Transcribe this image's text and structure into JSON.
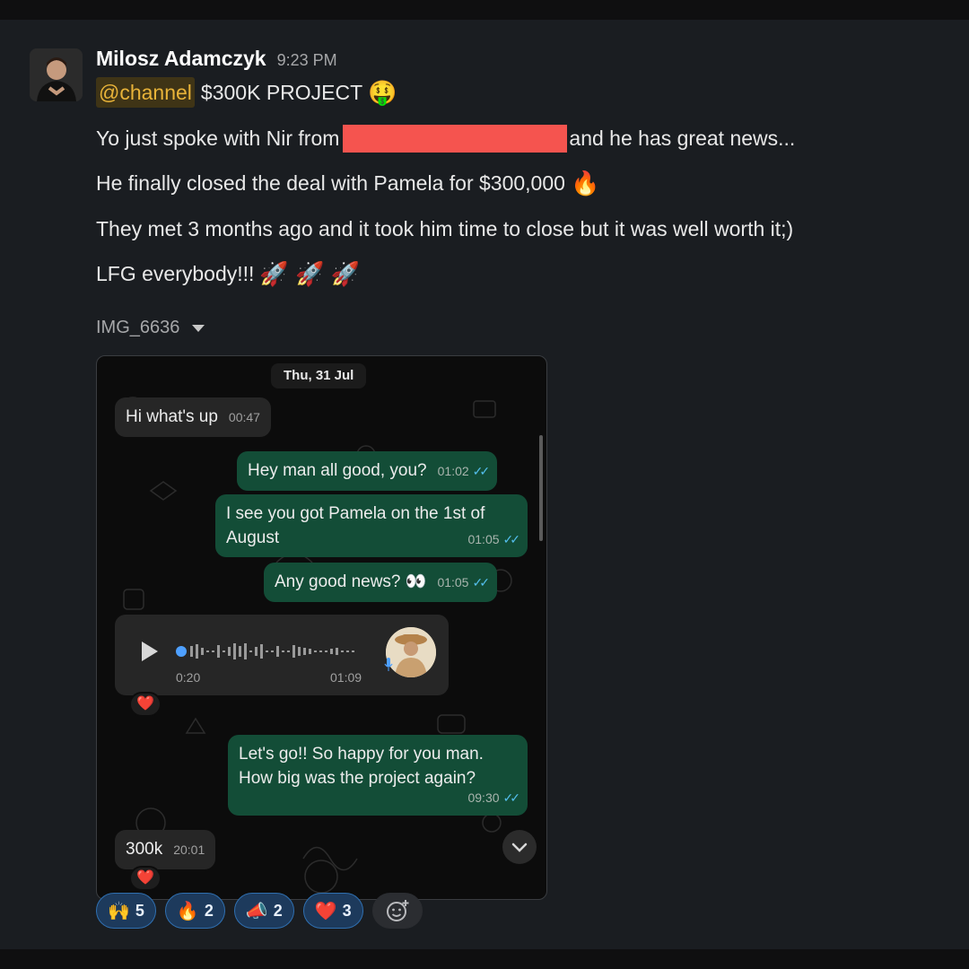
{
  "message": {
    "author": "Milosz Adamczyk",
    "time": "9:23 PM",
    "mention": "@channel",
    "headline": "$300K PROJECT",
    "headline_emoji": "🤑",
    "line1_before": "Yo just spoke with Nir from",
    "line1_after": "and he has great news...",
    "line2": "He finally closed the deal with Pamela for $300,000",
    "line2_emoji": "🔥",
    "line3": "They met 3 months ago and it took him time to close but it was well worth it;)",
    "line4": "LFG everybody!!!",
    "line4_emoji": "🚀 🚀 🚀",
    "attachment_name": "IMG_6636"
  },
  "chat": {
    "date": "Thu, 31 Jul",
    "messages": [
      {
        "text": "Hi what's up",
        "time": "00:47"
      },
      {
        "text": "Hey man all good, you?",
        "time": "01:02"
      },
      {
        "text_line1": "I see you got Pamela on the 1st of",
        "text_line2": "August",
        "time": "01:05"
      },
      {
        "text": "Any good news? 👀",
        "time": "01:05"
      },
      {
        "voice_position": "0:20",
        "voice_duration": "01:09",
        "reaction": "❤️"
      },
      {
        "text_line1": "Let's go!! So happy for you man.",
        "text_line2": "How big was the project again?",
        "time": "09:30"
      },
      {
        "text": "300k",
        "time": "20:01",
        "reaction": "❤️"
      }
    ]
  },
  "reactions": [
    {
      "emoji": "🙌",
      "count": "5",
      "icon": "raised-hands-icon"
    },
    {
      "emoji": "🔥",
      "count": "2",
      "icon": "fire-icon"
    },
    {
      "emoji": "📣",
      "count": "2",
      "icon": "megaphone-icon"
    },
    {
      "emoji": "❤️",
      "count": "3",
      "icon": "heart-icon"
    }
  ],
  "colors": {
    "background": "#1a1d21",
    "mention": "#e8b339",
    "redaction": "#f5544f",
    "outgoing_bubble": "#134d37",
    "incoming_bubble": "#262626",
    "reaction_pill": "#1d3a5c"
  }
}
